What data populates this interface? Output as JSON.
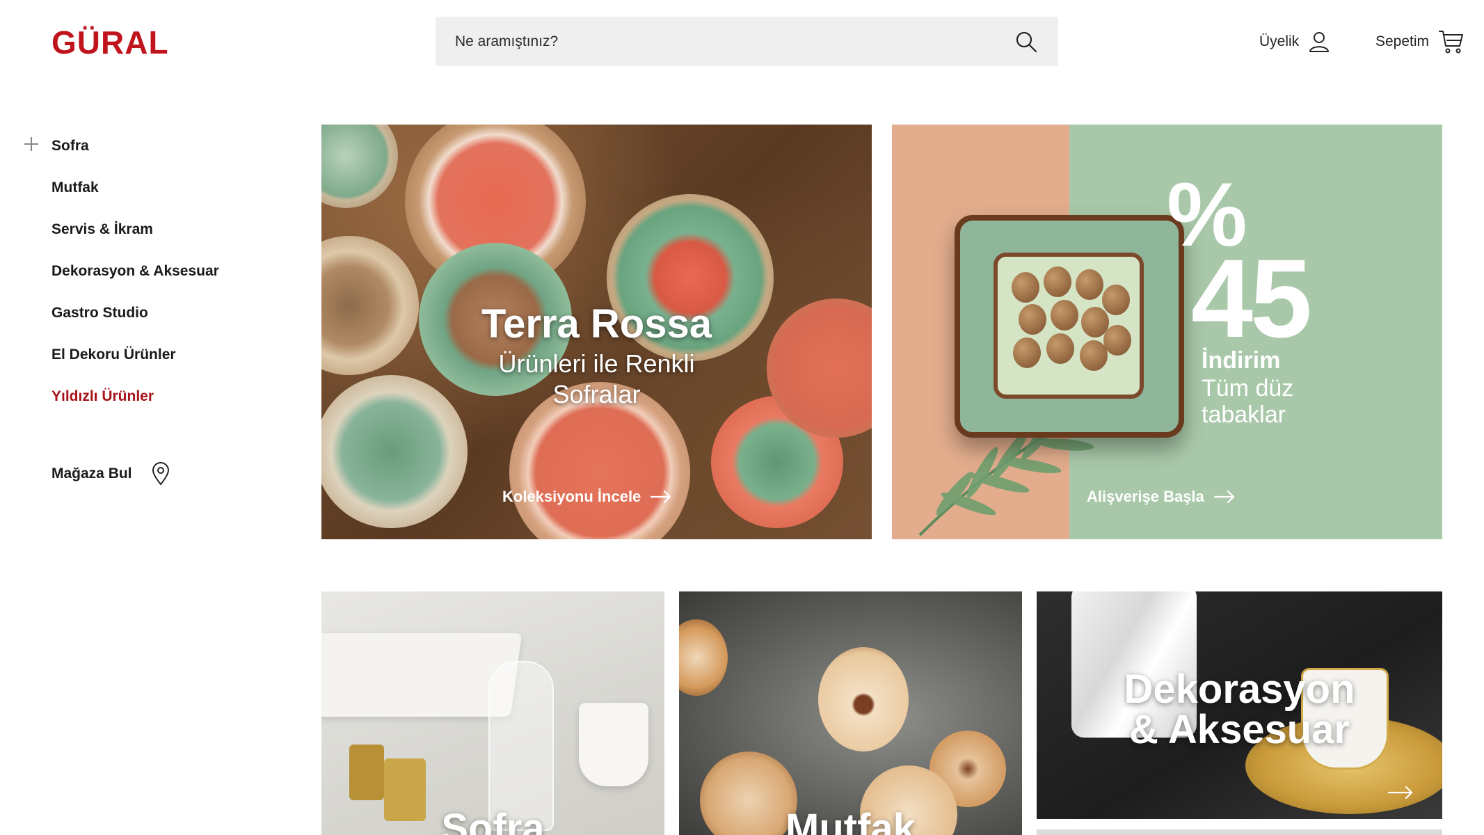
{
  "header": {
    "logo": "GÜRAL",
    "search_placeholder": "Ne aramıştınız?",
    "member_label": "Üyelik",
    "cart_label": "Sepetim"
  },
  "sidebar": {
    "items": [
      {
        "label": "Sofra",
        "expandable": true
      },
      {
        "label": "Mutfak"
      },
      {
        "label": "Servis & İkram"
      },
      {
        "label": "Dekorasyon & Aksesuar"
      },
      {
        "label": "Gastro Studio"
      },
      {
        "label": "El Dekoru Ürünler"
      },
      {
        "label": "Yıldızlı Ürünler",
        "active": true
      }
    ],
    "store_label": "Mağaza Bul"
  },
  "banners": {
    "terra": {
      "title": "Terra Rossa",
      "subtitle_line1": "Ürünleri ile Renkli",
      "subtitle_line2": "Sofralar",
      "cta": "Koleksiyonu İncele"
    },
    "discount": {
      "percent_sign": "%",
      "percent_value": "45",
      "label": "İndirim",
      "desc_line1": "Tüm düz",
      "desc_line2": "tabaklar",
      "cta": "Alişverişe Başla"
    }
  },
  "categories": [
    {
      "label": "Sofra"
    },
    {
      "label": "Mutfak"
    },
    {
      "label_line1": "Dekorasyon",
      "label_line2": "& Aksesuar"
    }
  ],
  "colors": {
    "brand": "#c0141c",
    "active_nav": "#a8121a",
    "search_bg": "#efefef",
    "discount_peach": "#e3ad8d",
    "discount_green": "#a9c8a9"
  },
  "icons": {
    "search": "search-icon",
    "member": "user-icon",
    "cart": "cart-icon",
    "expand": "plus-icon",
    "store": "location-pin-icon",
    "cta": "arrow-right-icon"
  }
}
